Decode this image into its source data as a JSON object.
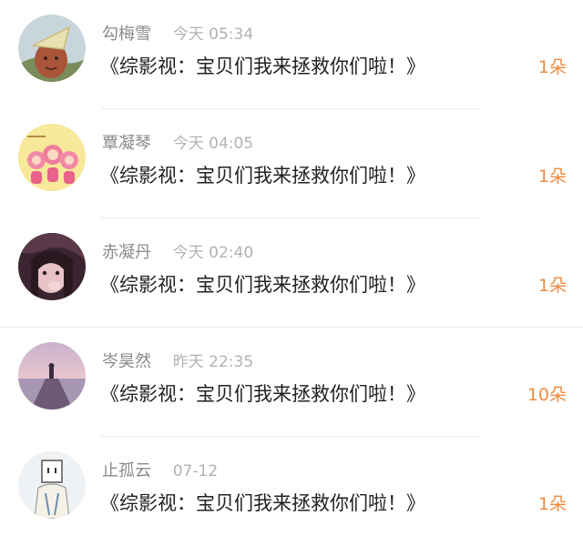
{
  "accent_color": "#ee8b41",
  "items": [
    {
      "name": "勾梅雪",
      "time": "今天 05:34",
      "message": "《综影视：宝贝们我来拯救你们啦！》",
      "count": "1朵",
      "avatar": "avatar-pumpkin-hat"
    },
    {
      "name": "覃凝琴",
      "time": "今天 04:05",
      "message": "《综影视：宝贝们我来拯救你们啦！》",
      "count": "1朵",
      "avatar": "avatar-pink-monkeys"
    },
    {
      "name": "赤凝丹",
      "time": "今天 02:40",
      "message": "《综影视：宝贝们我来拯救你们啦！》",
      "count": "1朵",
      "avatar": "avatar-girl-photo"
    },
    {
      "name": "岑昊然",
      "time": "昨天 22:35",
      "message": "《综影视：宝贝们我来拯救你们啦！》",
      "count": "10朵",
      "avatar": "avatar-pier-sunset"
    },
    {
      "name": "止孤云",
      "time": "07-12",
      "message": "《综影视：宝贝们我来拯救你们啦！》",
      "count": "1朵",
      "avatar": "avatar-box-head-figure"
    }
  ]
}
